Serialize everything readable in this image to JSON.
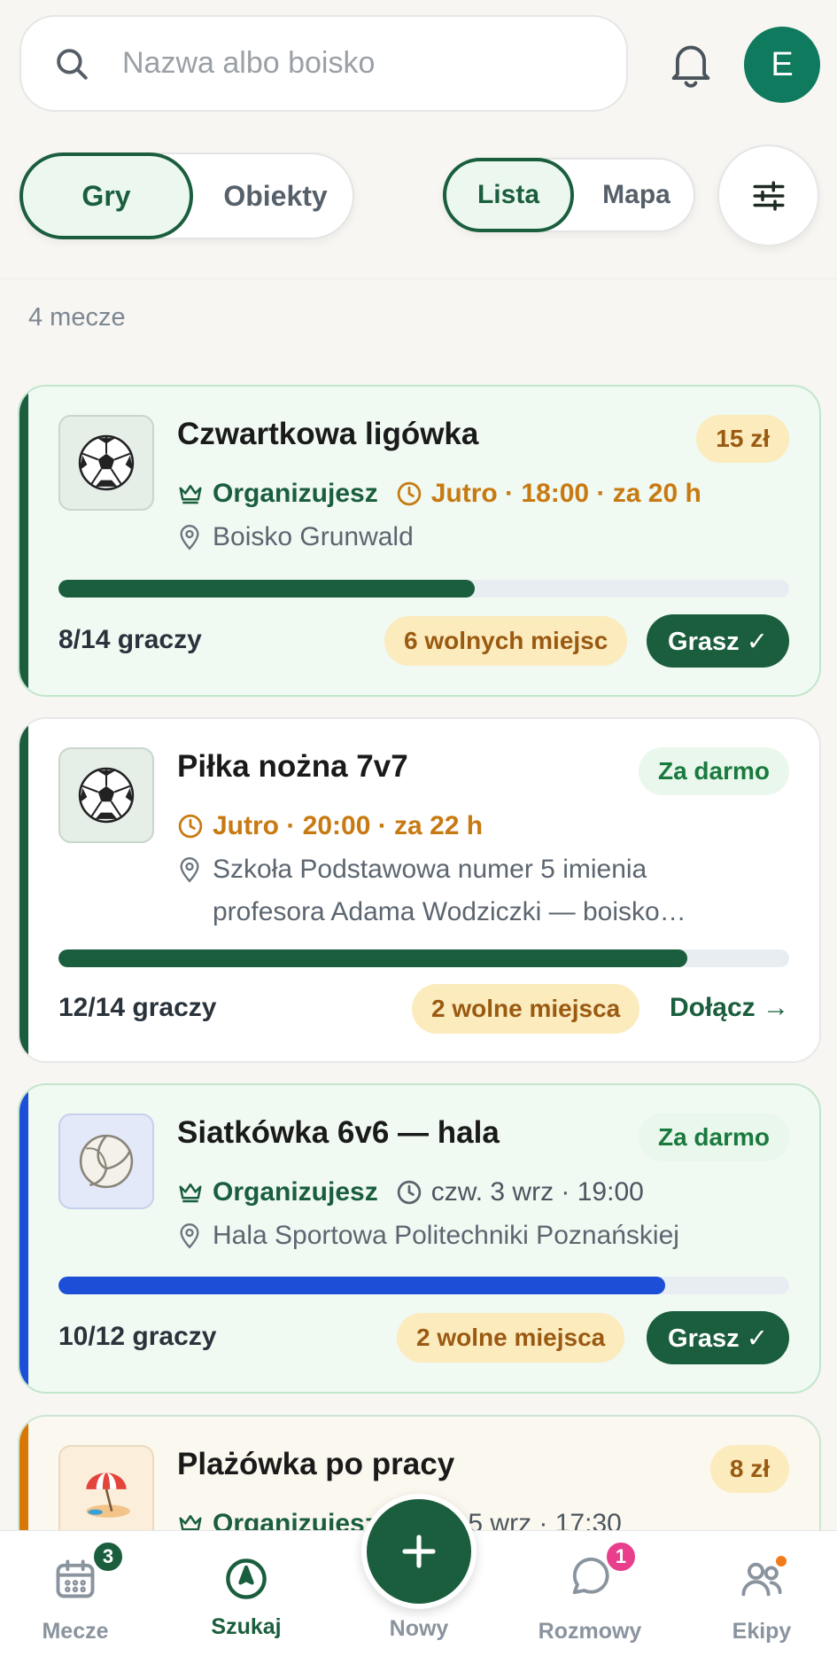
{
  "search": {
    "placeholder": "Nazwa albo boisko"
  },
  "user": {
    "avatar_initial": "E"
  },
  "segments": {
    "mode": [
      "Gry",
      "Obiekty"
    ],
    "view": [
      "Lista",
      "Mapa"
    ]
  },
  "results_count": "4 mecze",
  "matches": [
    {
      "title": "Czwartkowa ligówka",
      "price": "15 zł",
      "organizer_label": "Organizujesz",
      "time": "Jutro · 18:00 · za 20 h",
      "location": "Boisko Grunwald",
      "players": "8/14 graczy",
      "progress": 0.57,
      "slots": "6 wolnych miejsc",
      "action": "Grasz ✓",
      "sport_icon": "soccer-ball-icon",
      "accent": "#1a5e3d"
    },
    {
      "title": "Piłka nożna 7v7",
      "price": "Za darmo",
      "time": "Jutro · 20:00 · za 22 h",
      "location": "Szkoła Podstawowa numer 5 imienia profesora Adama Wodziczki — boisko…",
      "players": "12/14 graczy",
      "progress": 0.86,
      "slots": "2 wolne miejsca",
      "action": "Dołącz →",
      "sport_icon": "soccer-ball-icon",
      "accent": "#1a5e3d"
    },
    {
      "title": "Siatkówka 6v6 — hala",
      "price": "Za darmo",
      "organizer_label": "Organizujesz",
      "time": "czw. 3 wrz · 19:00",
      "location": "Hala Sportowa Politechniki Poznańskiej",
      "players": "10/12 graczy",
      "progress": 0.83,
      "slots": "2 wolne miejsca",
      "action": "Grasz ✓",
      "sport_icon": "volleyball-icon",
      "accent": "#1d4ed8"
    },
    {
      "title": "Plażówka po pracy",
      "price": "8 zł",
      "organizer_label": "Organizujesz",
      "time": "pt. 5 wrz · 17:30",
      "sport_icon": "beach-umbrella-icon",
      "accent": "#d97706"
    }
  ],
  "nav": {
    "matches": {
      "label": "Mecze",
      "badge": "3"
    },
    "search": {
      "label": "Szukaj"
    },
    "new": {
      "label": "Nowy"
    },
    "chats": {
      "label": "Rozmowy",
      "badge": "1"
    },
    "teams": {
      "label": "Ekipy"
    }
  },
  "colors": {
    "brand_green": "#1a5e3d",
    "avatar": "#0f7a5e",
    "warning": "#c87a12",
    "volleyball_blue": "#1d4ed8",
    "beach_orange": "#d97706"
  }
}
